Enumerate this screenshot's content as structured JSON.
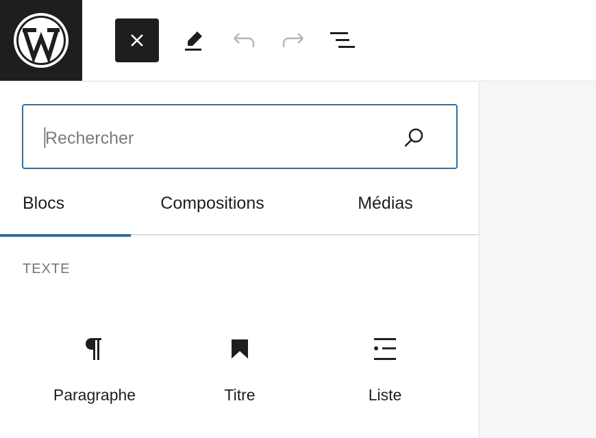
{
  "topbar": {
    "logo_icon": "wordpress-logo-icon",
    "close_icon": "close-icon",
    "edit_icon": "pencil-icon",
    "undo_icon": "undo-icon",
    "redo_icon": "redo-icon",
    "outline_icon": "list-view-icon"
  },
  "search": {
    "placeholder": "Rechercher",
    "icon": "search-icon"
  },
  "tabs": [
    {
      "label": "Blocs",
      "active": true
    },
    {
      "label": "Compositions",
      "active": false
    },
    {
      "label": "Médias",
      "active": false
    }
  ],
  "section": {
    "title": "TEXTE"
  },
  "blocks": [
    {
      "label": "Paragraphe",
      "icon": "paragraph-icon"
    },
    {
      "label": "Titre",
      "icon": "heading-bookmark-icon"
    },
    {
      "label": "Liste",
      "icon": "list-icon"
    }
  ],
  "colors": {
    "accent": "#2e6ea0",
    "dark": "#1e1e1e",
    "muted": "#757575",
    "canvas": "#f6f6f6"
  }
}
